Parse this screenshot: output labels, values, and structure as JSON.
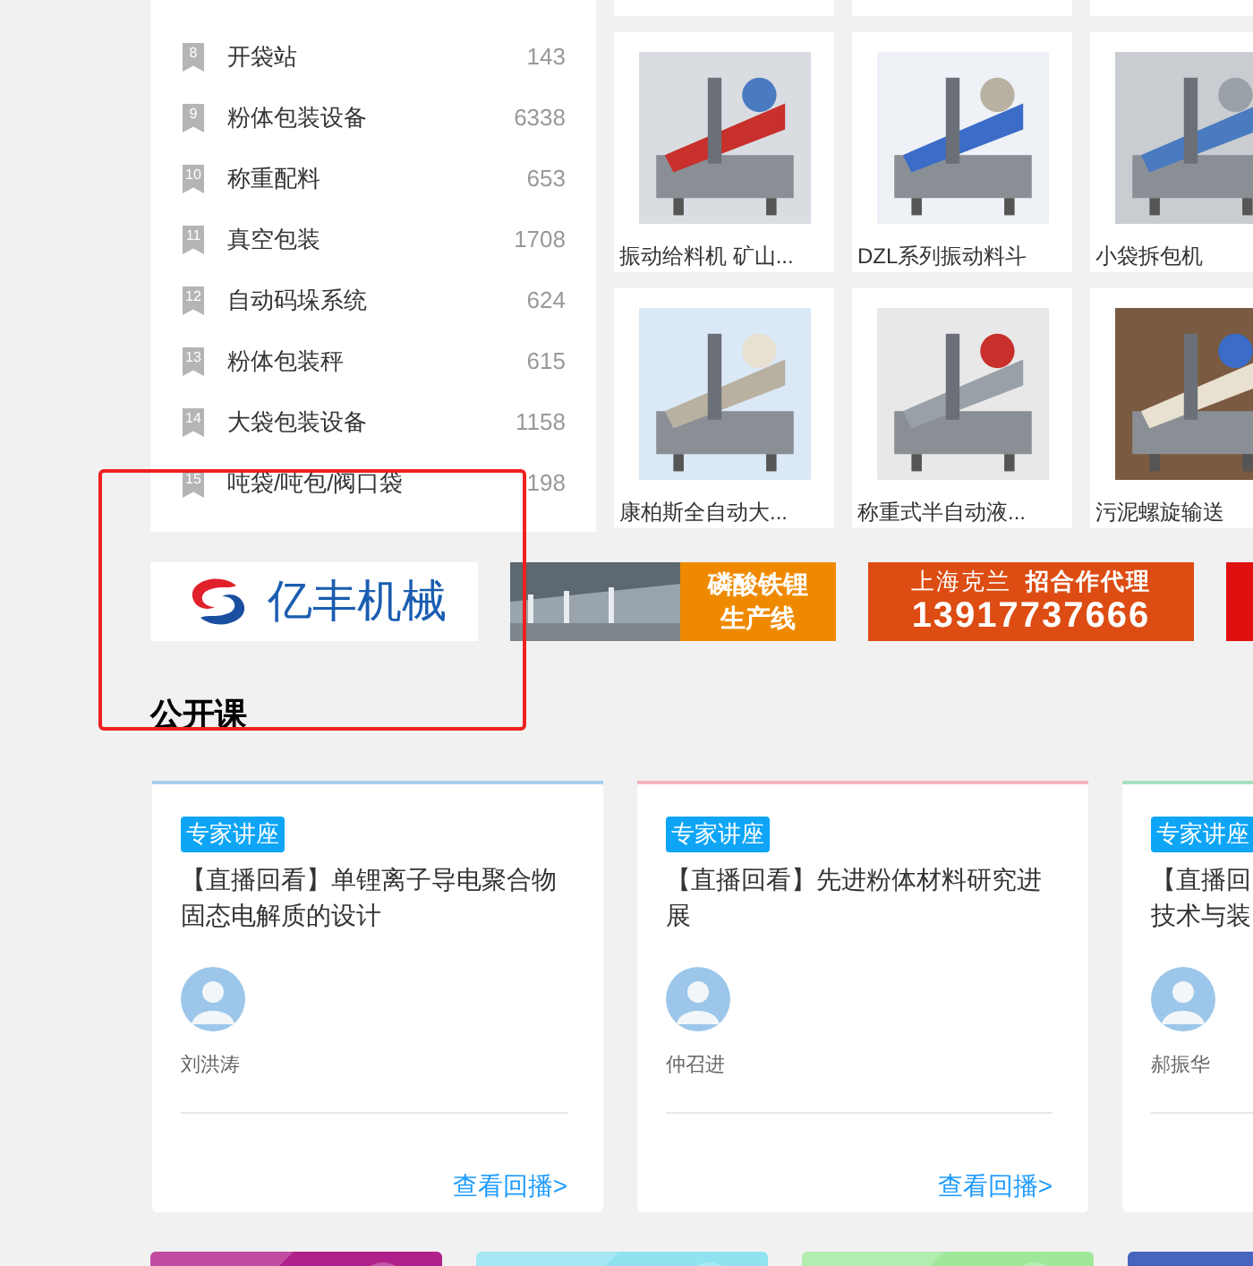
{
  "categories": [
    {
      "rank": "8",
      "name": "开袋站",
      "count": "143"
    },
    {
      "rank": "9",
      "name": "粉体包装设备",
      "count": "6338"
    },
    {
      "rank": "10",
      "name": "称重配料",
      "count": "653"
    },
    {
      "rank": "11",
      "name": "真空包装",
      "count": "1708"
    },
    {
      "rank": "12",
      "name": "自动码垛系统",
      "count": "624"
    },
    {
      "rank": "13",
      "name": "粉体包装秤",
      "count": "615"
    },
    {
      "rank": "14",
      "name": "大袋包装设备",
      "count": "1158"
    },
    {
      "rank": "15",
      "name": "吨袋/吨包/阀口袋",
      "count": "198"
    }
  ],
  "products": [
    {
      "title": "振动给料机 矿山...",
      "kind": "picture"
    },
    {
      "title": "DZL系列振动料斗",
      "kind": "picture"
    },
    {
      "title": "小袋拆包机",
      "kind": "picture"
    },
    {
      "title": "康柏斯全自动大...",
      "kind": "picture"
    },
    {
      "title": "称重式半自动液...",
      "kind": "picture"
    },
    {
      "title": "污泥螺旋输送",
      "kind": "picture"
    }
  ],
  "banners": [
    {
      "kind": "logo",
      "text": "亿丰机械"
    },
    {
      "lines": [
        "磷酸铁锂",
        "生产线"
      ]
    },
    {
      "kind": "contact",
      "company": "上海克兰",
      "slogan": "招合作代理",
      "phone": "13917737666"
    },
    {
      "kind": "cut"
    }
  ],
  "section_title": "公开课",
  "lectures": [
    {
      "color": "#a8cdf0",
      "badge": "专家讲座",
      "title": "【直播回看】单锂离子导电聚合物固态电解质的设计",
      "speaker": "刘洪涛",
      "link": "查看回播>"
    },
    {
      "color": "#f7b4bc",
      "badge": "专家讲座",
      "title": "【直播回看】先进粉体材料研究进展",
      "speaker": "仲召进",
      "link": "查看回播>"
    },
    {
      "color": "#a6e0c0",
      "badge": "专家讲座",
      "title_lines": [
        "【直播回",
        "技术与装"
      ],
      "speaker": "郝振华"
    }
  ]
}
